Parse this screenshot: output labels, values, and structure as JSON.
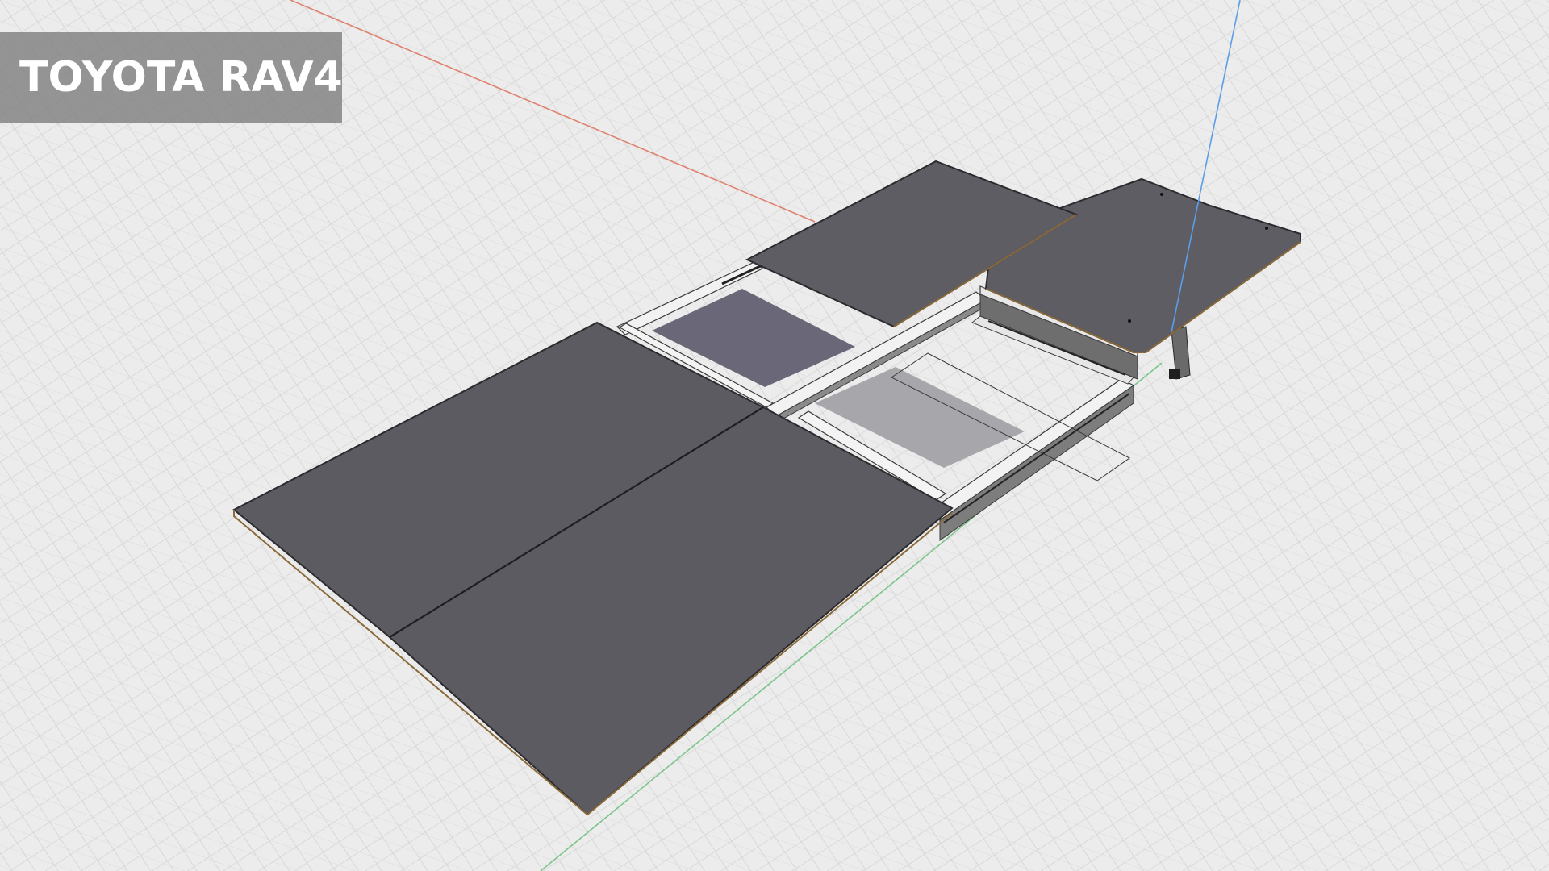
{
  "title": "TOYOTA RAV4",
  "colors": {
    "background": "#ececec",
    "grid_line": "#d2d2d2",
    "axis_red": "#e0806e",
    "axis_green": "#7cc48a",
    "axis_blue": "#5a9ee8",
    "panel_fill": "#5e5d63",
    "panel_edge": "#2b2a2e",
    "panel_edge_wood": "#8a6a3a",
    "rail_light": "#f2f2f2",
    "rail_dark": "#7a7a7a",
    "floor_purple": "#6a6878",
    "floor_grey": "#a7a6aa",
    "title_badge": "#808080",
    "title_text": "#ffffff"
  },
  "icons": {
    "model_view": "3d-model",
    "title_badge": "label-badge"
  }
}
